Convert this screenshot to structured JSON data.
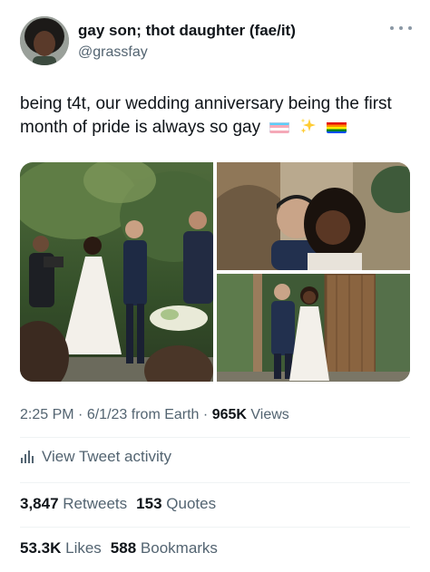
{
  "author": {
    "display_name": "gay son; thot daughter (fae/it)",
    "handle": "@grassfay"
  },
  "tweet": {
    "text": "being t4t, our wedding anniversary being the first month of pride is always so gay",
    "emojis": [
      "transgender-flag-icon",
      "sparkles-icon",
      "rainbow-flag-icon"
    ]
  },
  "meta": {
    "time": "2:25 PM",
    "sep1": "·",
    "date": "6/1/23",
    "source": "from Earth",
    "sep2": "·",
    "views_count": "965K",
    "views_label": "Views"
  },
  "activity": {
    "label": "View Tweet activity"
  },
  "stats": {
    "retweets_count": "3,847",
    "retweets_label": "Retweets",
    "quotes_count": "153",
    "quotes_label": "Quotes",
    "likes_count": "53.3K",
    "likes_label": "Likes",
    "bookmarks_count": "588",
    "bookmarks_label": "Bookmarks"
  },
  "colors": {
    "text_primary": "#0f1419",
    "text_secondary": "#536471",
    "divider": "#eff3f4"
  }
}
